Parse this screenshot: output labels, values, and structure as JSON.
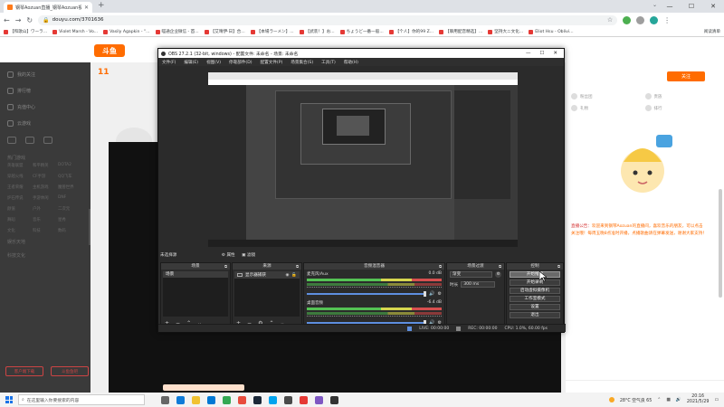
{
  "browser": {
    "tab_title": "钢琴Aozuan直播_钢琴Aozuan视频直播 - 斗鱼",
    "address": "douyu.com/3701636",
    "bookmarks": [
      "【和歌山】ワーラ...",
      "Violet Marsh - Vo...",
      "Vasily Agapkin - \"...",
      "喵通企业微信 - 首...",
      "【艾晴伊·日】合...",
      "【本場ラーメン】...",
      "【武装！】お...",
      "ちょうど一番一般...",
      "【个人】你的99 Z...",
      "【聊用配音精选】...",
      "坚持大ニ文化...",
      "Eliot Hsu - Oblivi..."
    ],
    "bookmarks_more": "阅读清单"
  },
  "page": {
    "logo": "斗鱼",
    "streamer_count": "11",
    "sidebar_items": [
      "我的关注",
      "排行榜",
      "充值中心",
      "云游戏"
    ],
    "sidebar_sections": [
      "热门游戏",
      "娱乐天地",
      "科技文化"
    ],
    "sidebar_grid": [
      "英雄联盟",
      "和平精英",
      "DOTA2",
      "穿越火线",
      "CF手游",
      "QQ飞车",
      "王者荣耀",
      "主机游戏",
      "魔兽世界",
      "炉石传说",
      "手游休闲",
      "DNF",
      "颜值",
      "户外",
      "二次元",
      "舞蹈",
      "音乐",
      "星秀",
      "文化",
      "科技",
      "数码"
    ],
    "sidebar_footer": [
      "客户端下载",
      "斗鱼鱼吧"
    ],
    "follow_button": "关注",
    "gift_labels": [
      "粉丝团",
      "贵族",
      "礼物",
      "排行"
    ],
    "notice_head": "直播公告：",
    "notice_text": "欢迎来到钢琴Aozuan的直播间，喜欢音乐的朋友，可以点击关注哦！每周五晚8点准时开播，点播歌曲请在弹幕发送，谢谢大家支持！"
  },
  "obs": {
    "title": "OBS 27.2.1 (32-bit, windows) - 配置文件: 未命名 - 场景: 未命名",
    "menu": [
      "文件(F)",
      "编辑(E)",
      "视图(V)",
      "停靠部件(D)",
      "配置文件(P)",
      "场景集合(S)",
      "工具(T)",
      "帮助(H)"
    ],
    "dock_label": "未选择源",
    "dock_label_props": "属性",
    "dock_label_filters": "滤镜",
    "scenes_header": "场景",
    "scene_item": "场景",
    "sources_header": "来源",
    "source_item": "显示器捕获",
    "mixer_header": "音频混音器",
    "mixer_tracks": [
      {
        "name": "麦克风/Aux",
        "db": "0.0 dB"
      },
      {
        "name": "桌面音频",
        "db": "-6.4 dB"
      }
    ],
    "transitions_header": "场景过渡",
    "transition_value": "渐变",
    "duration_label": "时长",
    "duration_value": "300 ms",
    "controls_header": "控制",
    "controls": [
      "开始推流",
      "开始录制",
      "启动虚拟摄像机",
      "工作室模式",
      "设置",
      "退出"
    ],
    "status": {
      "live": "LIVE: 00:00:00",
      "rec": "REC: 00:00:00",
      "cpu": "CPU: 1.0%, 60.00 fps"
    }
  },
  "taskbar": {
    "search_placeholder": "在这里输入你要搜索的内容",
    "weather": "28°C 空气良 65",
    "time": "20:16",
    "date": "2021/5/29"
  }
}
